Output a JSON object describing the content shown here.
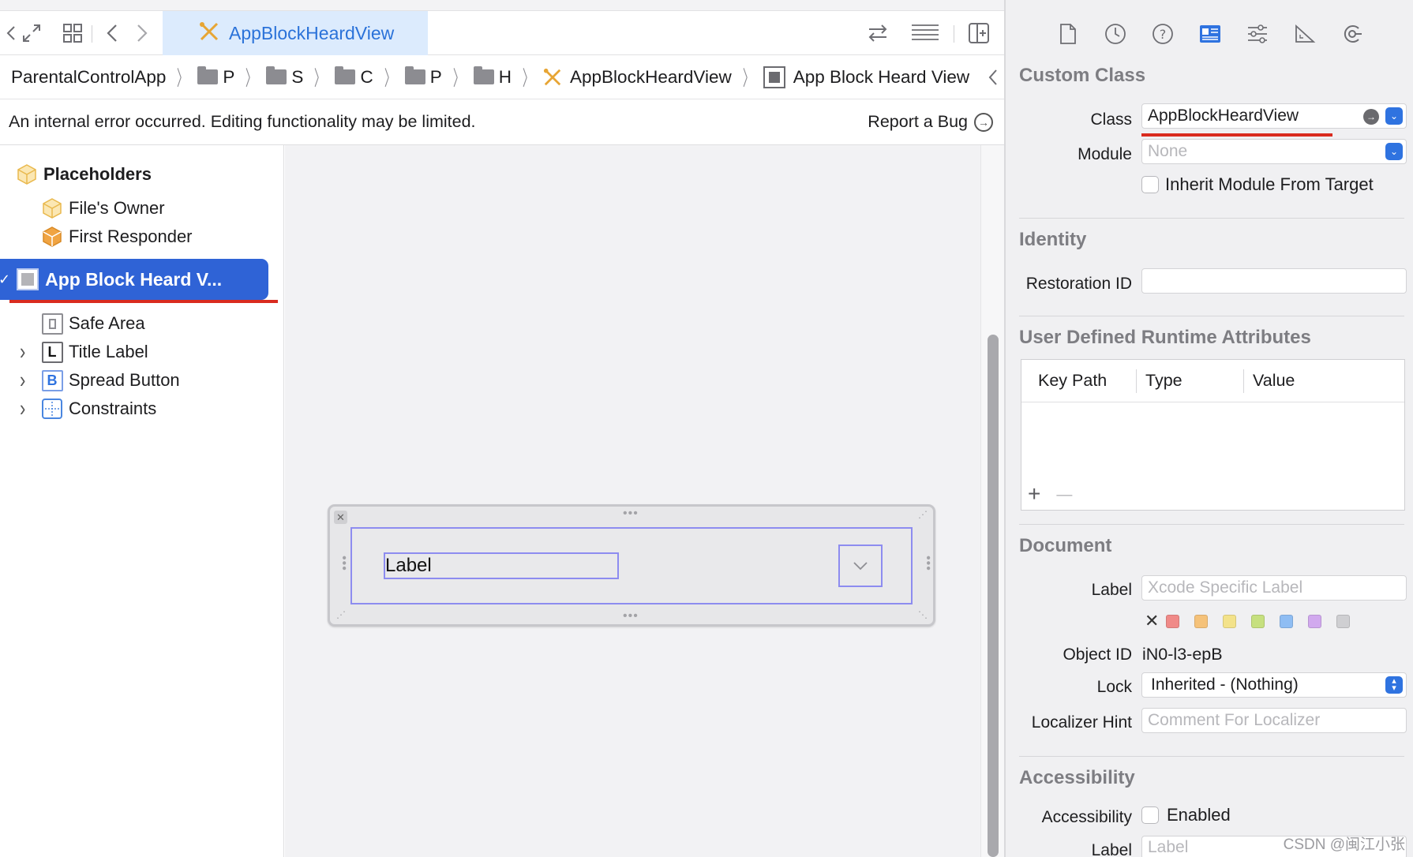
{
  "tabs": {
    "active_label": "AppBlockHeardView"
  },
  "jumpbar": {
    "project": "ParentalControlApp",
    "folders": [
      "P",
      "S",
      "C",
      "P",
      "H"
    ],
    "file": "AppBlockHeardView",
    "object": "App Block Heard View"
  },
  "error_bar": {
    "message": "An internal error occurred. Editing functionality may be limited.",
    "report": "Report a Bug"
  },
  "outline": {
    "placeholders": "Placeholders",
    "files_owner": "File's Owner",
    "first_responder": "First Responder",
    "selected": "App Block Heard V...",
    "safe_area": "Safe Area",
    "title_label": "Title Label",
    "spread_button": "Spread Button",
    "constraints": "Constraints"
  },
  "canvas": {
    "label_text": "Label"
  },
  "inspector": {
    "custom_class": {
      "title": "Custom Class",
      "class_label": "Class",
      "class_value": "AppBlockHeardView",
      "module_label": "Module",
      "module_placeholder": "None",
      "inherit_label": "Inherit Module From Target"
    },
    "identity": {
      "title": "Identity",
      "restoration_label": "Restoration ID",
      "restoration_value": ""
    },
    "runtime_attributes": {
      "title": "User Defined Runtime Attributes",
      "columns": [
        "Key Path",
        "Type",
        "Value"
      ],
      "add": "+",
      "remove": "—"
    },
    "document": {
      "title": "Document",
      "label_label": "Label",
      "label_placeholder": "Xcode Specific Label",
      "clear_color": "✕",
      "label_colors": [
        "#f08a88",
        "#f5c27a",
        "#f3e28a",
        "#c6e07f",
        "#8fbdf3",
        "#d1a9ee",
        "#cfcfd2"
      ],
      "object_id_label": "Object ID",
      "object_id_value": "iN0-l3-epB",
      "lock_label": "Lock",
      "lock_value": "Inherited - (Nothing)",
      "localizer_label": "Localizer Hint",
      "localizer_placeholder": "Comment For Localizer"
    },
    "accessibility": {
      "title": "Accessibility",
      "accessibility_label": "Accessibility",
      "enabled_label": "Enabled",
      "label_label": "Label",
      "label_placeholder": "Label"
    }
  },
  "watermark": "CSDN @闽江小张",
  "colors": {
    "accent": "#2f63d6",
    "tab_bg": "#dcebfd",
    "warning": "#f2b90c",
    "annotation_red": "#d92b1f"
  }
}
